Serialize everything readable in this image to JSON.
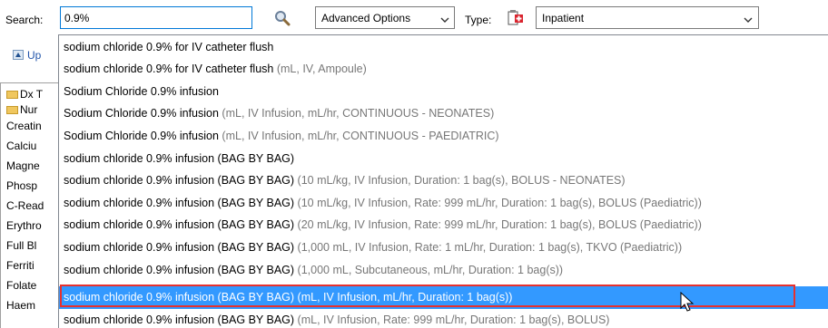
{
  "toolbar": {
    "search_label": "Search:",
    "search_value": "0.9%",
    "advanced_options_label": "Advanced Options",
    "type_label": "Type:",
    "type_value": "Inpatient"
  },
  "background": {
    "up_label": "Up",
    "left_items": [
      "Dx T",
      "Nur",
      "Creatin",
      "Calciu",
      "Magne",
      "Phosp",
      "C-Read",
      "Erythro",
      "Full Bl",
      "Ferriti",
      "Folate",
      "Haem"
    ]
  },
  "suggestions": [
    {
      "main": "sodium chloride 0.9% for IV catheter flush",
      "extra": ""
    },
    {
      "main": "sodium chloride 0.9% for IV catheter flush",
      "extra": " (mL, IV, Ampoule)"
    },
    {
      "main": "Sodium Chloride 0.9% infusion",
      "extra": ""
    },
    {
      "main": "Sodium Chloride 0.9% infusion",
      "extra": " (mL, IV Infusion, mL/hr, CONTINUOUS - NEONATES)"
    },
    {
      "main": "Sodium Chloride 0.9% infusion",
      "extra": " (mL, IV Infusion, mL/hr, CONTINUOUS - PAEDIATRIC)"
    },
    {
      "main": "sodium chloride 0.9% infusion (BAG BY BAG)",
      "extra": ""
    },
    {
      "main": "sodium chloride 0.9% infusion (BAG BY BAG)",
      "extra": " (10 mL/kg, IV Infusion, Duration: 1 bag(s), BOLUS - NEONATES)"
    },
    {
      "main": "sodium chloride 0.9% infusion (BAG BY BAG)",
      "extra": " (10 mL/kg, IV Infusion, Rate: 999 mL/hr, Duration: 1 bag(s), BOLUS (Paediatric))"
    },
    {
      "main": "sodium chloride 0.9% infusion (BAG BY BAG)",
      "extra": " (20 mL/kg, IV Infusion, Rate: 999 mL/hr, Duration: 1 bag(s), BOLUS (Paediatric))"
    },
    {
      "main": "sodium chloride 0.9% infusion (BAG BY BAG)",
      "extra": " (1,000 mL, IV Infusion, Rate: 1 mL/hr, Duration: 1 bag(s), TKVO (Paediatric))"
    },
    {
      "main": "sodium chloride 0.9% infusion (BAG BY BAG)",
      "extra": " (1,000 mL, Subcutaneous, mL/hr, Duration: 1 bag(s))"
    },
    {
      "main": "sodium chloride 0.9% infusion (BAG BY BAG)",
      "extra": " (mL, IV Infusion, mL/hr, Duration: 1 bag(s))"
    },
    {
      "main": "sodium chloride 0.9% infusion (BAG BY BAG)",
      "extra": " (mL, IV Infusion, Rate: 999 mL/hr, Duration: 1 bag(s), BOLUS)"
    }
  ],
  "selected_index": 11,
  "colors": {
    "selection": "#3399ff",
    "highlight_outline": "#e8312e",
    "secondary_text": "#777777"
  },
  "icons": [
    "search-icon",
    "chevron-down-icon",
    "inpatient-type-icon",
    "up-arrow-icon",
    "folder-icon",
    "mouse-pointer-icon"
  ]
}
